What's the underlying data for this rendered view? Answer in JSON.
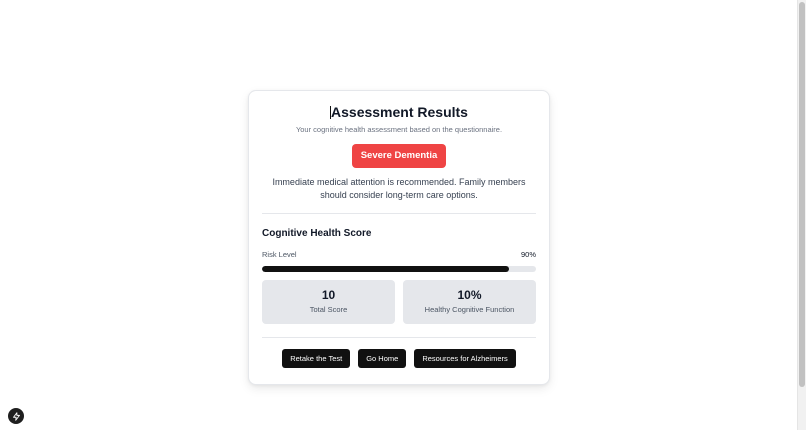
{
  "result": {
    "title": "Assessment Results",
    "subtitle": "Your cognitive health assessment based on the questionnaire.",
    "badge_label": "Severe Dementia",
    "badge_color": "#ef4444",
    "message": "Immediate medical attention is recommended. Family members should consider long-term care options."
  },
  "score": {
    "section_title": "Cognitive Health Score",
    "risk_label": "Risk Level",
    "risk_value_text": "90%",
    "risk_fraction": 0.9,
    "stats": [
      {
        "value": "10",
        "label": "Total Score"
      },
      {
        "value": "10%",
        "label": "Healthy Cognitive Function"
      }
    ]
  },
  "actions": {
    "retake_label": "Retake the Test",
    "home_label": "Go Home",
    "resources_label": "Resources for Alzheimers"
  },
  "icons": {
    "fab_icon": "bolt-icon"
  }
}
